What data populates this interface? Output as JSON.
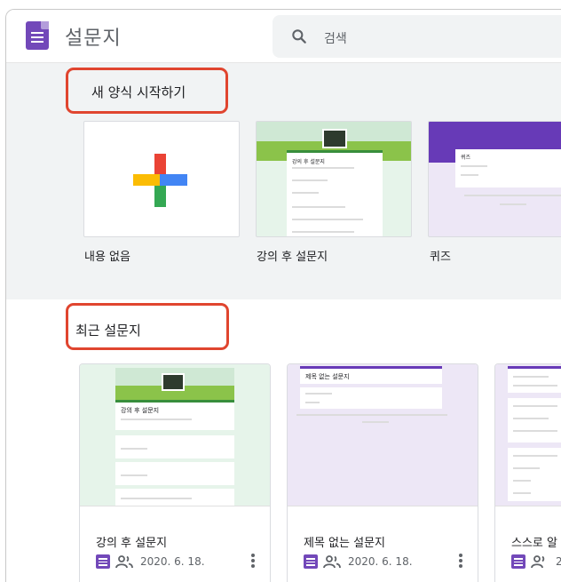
{
  "app": {
    "title": "설문지",
    "search_placeholder": "검색"
  },
  "templates": {
    "section_title": "새 양식 시작하기",
    "items": [
      {
        "label": "내용 없음"
      },
      {
        "label": "강의 후 설문지",
        "thumb_title": "강의 후 설문지"
      },
      {
        "label": "퀴즈",
        "thumb_title": "퀴즈"
      }
    ]
  },
  "recent": {
    "section_title": "최근 설문지",
    "items": [
      {
        "title": "강의 후 설문지",
        "date": "2020. 6. 18.",
        "thumb_title": "강의 후 설문지"
      },
      {
        "title": "제목 없는 설문지",
        "date": "2020. 6. 18.",
        "thumb_title": "제목 없는 설문지"
      },
      {
        "title": "스스로 알",
        "date": "2"
      }
    ]
  },
  "colors": {
    "brand_purple": "#7248b9",
    "highlight_red": "#e0452f",
    "plus_red": "#ea4335",
    "plus_blue": "#4285f4",
    "plus_green": "#34a853",
    "plus_yellow": "#fbbc04",
    "green_theme": "#e6f4ea"
  },
  "icons": [
    "forms-app-icon",
    "search-icon",
    "plus-icon",
    "hikers-icon",
    "shared-people-icon",
    "more-vert-icon"
  ]
}
